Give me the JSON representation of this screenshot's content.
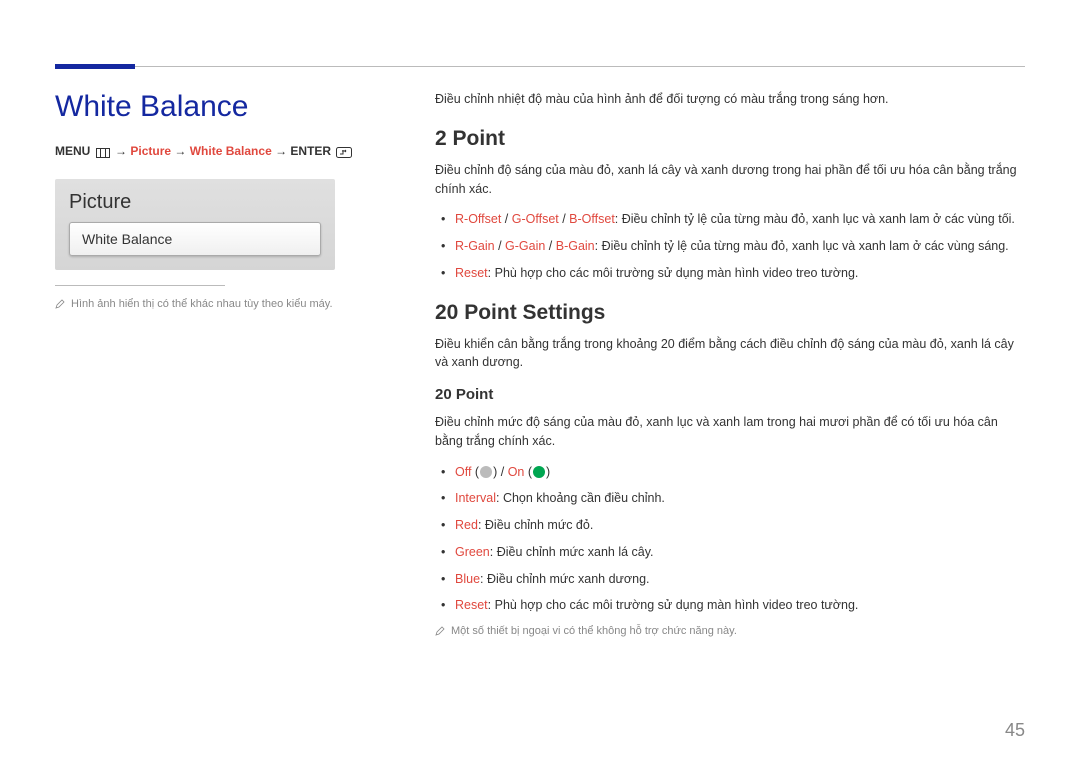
{
  "page_number": "45",
  "left": {
    "title": "White Balance",
    "breadcrumb": {
      "menu_label": "MENU",
      "path1": "Picture",
      "path2": "White Balance",
      "enter_label": "ENTER"
    },
    "panel": {
      "title": "Picture",
      "item": "White Balance"
    },
    "note": "Hình ảnh hiển thị có thể khác nhau tùy theo kiểu máy."
  },
  "right": {
    "intro": "Điều chỉnh nhiệt độ màu của hình ảnh để đối tượng có màu trắng trong sáng hơn.",
    "section1": {
      "heading": "2 Point",
      "para": "Điều chỉnh độ sáng của màu đỏ, xanh lá cây và xanh dương trong hai phần để tối ưu hóa cân bằng trắng chính xác.",
      "bullets": {
        "b1_terms": [
          "R-Offset",
          "G-Offset",
          "B-Offset"
        ],
        "b1_text": ": Điều chỉnh tỷ lệ của từng màu đỏ, xanh lục và xanh lam ở các vùng tối.",
        "b2_terms": [
          "R-Gain",
          "G-Gain",
          "B-Gain"
        ],
        "b2_text": ": Điều chỉnh tỷ lệ của từng màu đỏ, xanh lục và xanh lam ở các vùng sáng.",
        "b3_term": "Reset",
        "b3_text": ": Phù hợp cho các môi trường sử dụng màn hình video treo tường."
      }
    },
    "section2": {
      "heading": "20 Point Settings",
      "para": "Điều khiển cân bằng trắng trong khoảng 20 điểm bằng cách điều chỉnh độ sáng của màu đỏ, xanh lá cây và xanh dương.",
      "sub": {
        "heading": "20 Point",
        "para": "Điều chỉnh mức độ sáng của màu đỏ, xanh lục và xanh lam trong hai mươi phần để có tối ưu hóa cân bằng trắng chính xác.",
        "bullets": {
          "off": "Off",
          "on": "On",
          "interval_term": "Interval",
          "interval_text": ": Chọn khoảng cần điều chỉnh.",
          "red_term": "Red",
          "red_text": ": Điều chỉnh mức đỏ.",
          "green_term": "Green",
          "green_text": ": Điều chỉnh mức xanh lá cây.",
          "blue_term": "Blue",
          "blue_text": ": Điều chỉnh mức xanh dương.",
          "reset_term": "Reset",
          "reset_text": ": Phù hợp cho các môi trường sử dụng màn hình video treo tường."
        },
        "footnote": "Một số thiết bị ngoại vi có thể không hỗ trợ chức năng này."
      }
    }
  }
}
